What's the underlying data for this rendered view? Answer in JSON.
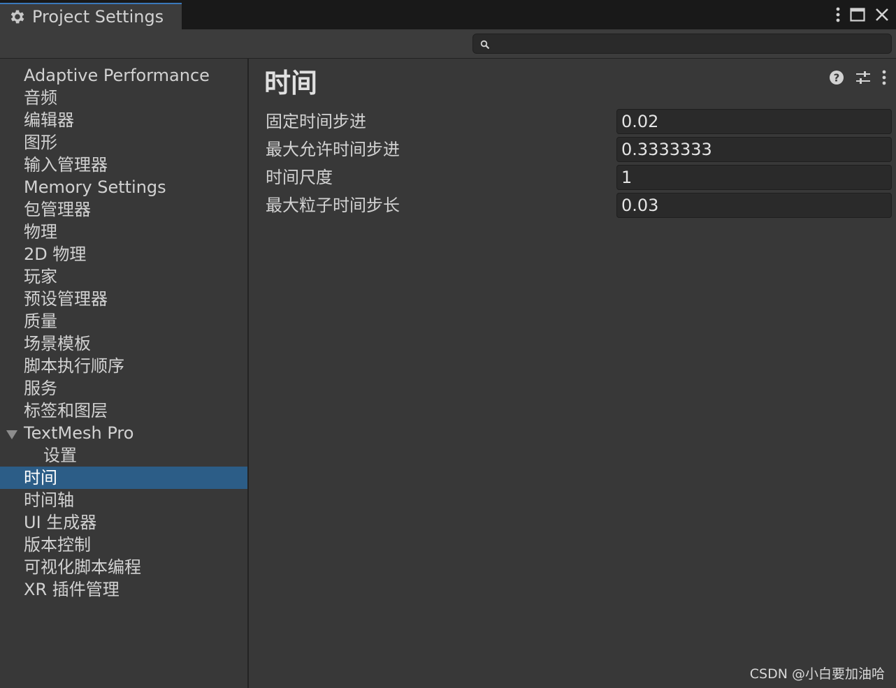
{
  "window": {
    "tab_title": "Project Settings",
    "tab_icon": "gear-icon",
    "buttons": [
      "more-options-icon",
      "maximize-icon",
      "close-icon"
    ]
  },
  "search": {
    "value": "",
    "placeholder": "",
    "icon": "search-icon"
  },
  "sidebar": {
    "items": [
      {
        "label": "Adaptive Performance"
      },
      {
        "label": "音频"
      },
      {
        "label": "编辑器"
      },
      {
        "label": "图形"
      },
      {
        "label": "输入管理器"
      },
      {
        "label": "Memory Settings"
      },
      {
        "label": "包管理器"
      },
      {
        "label": "物理"
      },
      {
        "label": "2D 物理"
      },
      {
        "label": "玩家"
      },
      {
        "label": "预设管理器"
      },
      {
        "label": "质量"
      },
      {
        "label": "场景模板"
      },
      {
        "label": "脚本执行顺序"
      },
      {
        "label": "服务"
      },
      {
        "label": "标签和图层"
      },
      {
        "label": "TextMesh Pro",
        "expanded": true
      },
      {
        "label": "设置",
        "child": true
      },
      {
        "label": "时间",
        "selected": true
      },
      {
        "label": "时间轴"
      },
      {
        "label": "UI 生成器"
      },
      {
        "label": "版本控制"
      },
      {
        "label": "可视化脚本编程"
      },
      {
        "label": "XR 插件管理"
      }
    ]
  },
  "main": {
    "title": "时间",
    "header_icons": [
      "help-icon",
      "preset-sliders-icon",
      "more-options-icon"
    ],
    "fields": [
      {
        "label": "固定时间步进",
        "value": "0.02"
      },
      {
        "label": "最大允许时间步进",
        "value": "0.3333333"
      },
      {
        "label": "时间尺度",
        "value": "1"
      },
      {
        "label": "最大粒子时间步长",
        "value": "0.03"
      }
    ]
  },
  "watermark": "CSDN @小白要加油哈",
  "colors": {
    "selection": "#2c5d87",
    "tab_accent": "#3a79bb",
    "background": "#383838"
  }
}
